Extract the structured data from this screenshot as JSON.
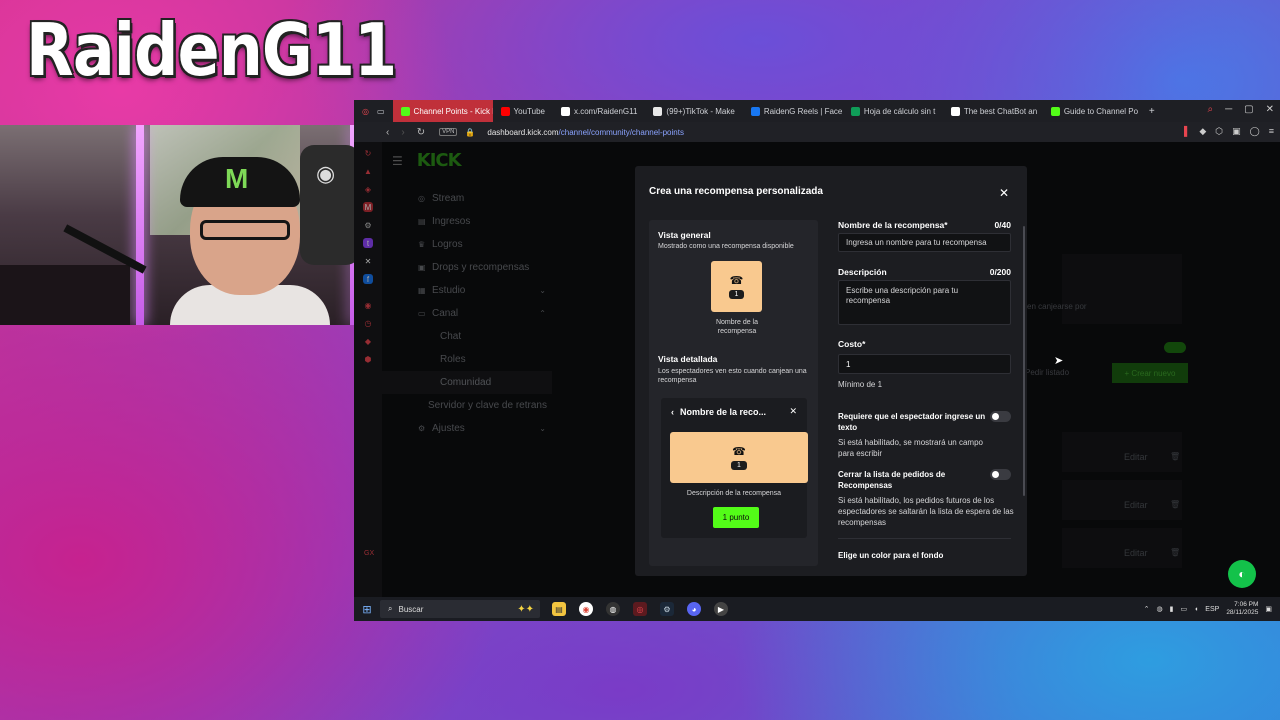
{
  "overlay": {
    "streamer_name": "RaidenG11"
  },
  "browser": {
    "tabs": [
      {
        "label": "Channel Points - Kick Da",
        "color": "#53fc18",
        "active": true
      },
      {
        "label": "YouTube",
        "color": "#ff0000"
      },
      {
        "label": "x.com/RaidenG11",
        "color": "#ffffff"
      },
      {
        "label": "(99+)TikTok - Make",
        "color": "#e8e8e8"
      },
      {
        "label": "RaidenG Reels | Face",
        "color": "#1877f2"
      },
      {
        "label": "Hoja de cálculo sin t",
        "color": "#0f9d58"
      },
      {
        "label": "The best ChatBot an",
        "color": "#ffffff"
      },
      {
        "label": "Guide to Channel Po",
        "color": "#53fc18"
      }
    ],
    "vpn_badge": "VPN",
    "url_host": "dashboard.kick.com",
    "url_path": "/channel/community/channel-points"
  },
  "kick": {
    "logo": "KICK",
    "sidebar": [
      {
        "label": "Stream",
        "icon": "radio-icon",
        "glyph": "◎",
        "level": "top"
      },
      {
        "label": "Ingresos",
        "icon": "money-icon",
        "glyph": "▤",
        "level": "top"
      },
      {
        "label": "Logros",
        "icon": "trophy-icon",
        "glyph": "♛",
        "level": "top"
      },
      {
        "label": "Drops y recompensas",
        "icon": "gift-icon",
        "glyph": "▣",
        "level": "top"
      },
      {
        "label": "Estudio",
        "icon": "studio-icon",
        "glyph": "▦",
        "level": "top",
        "chevron": "⌄"
      },
      {
        "label": "Canal",
        "icon": "channel-icon",
        "glyph": "▭",
        "level": "top",
        "chevron": "⌃"
      },
      {
        "label": "Chat",
        "level": "sub"
      },
      {
        "label": "Roles",
        "level": "sub"
      },
      {
        "label": "Comunidad",
        "level": "sub",
        "active": true
      },
      {
        "label": "Servidor y clave de retrans",
        "level": "plain"
      },
      {
        "label": "Ajustes",
        "icon": "settings-icon",
        "glyph": "⚙",
        "level": "top",
        "chevron": "⌄"
      }
    ],
    "bg": {
      "redeem_text": "en canjearse por",
      "edit_list": "Pedir listado",
      "create_new": "+ Crear nuevo",
      "edit_label": "Editar"
    }
  },
  "modal": {
    "title": "Crea una recompensa personalizada",
    "overview_title": "Vista general",
    "overview_sub": "Mostrado como una recompensa disponible",
    "tile_cost": "1",
    "tile_name": "Nombre de la recompensa",
    "detail_title": "Vista detallada",
    "detail_sub": "Los espectadores ven esto cuando canjean una recompensa",
    "detail_card_title": "Nombre de la reco...",
    "detail_card_desc": "Descripción de la recompensa",
    "points_button": "1 punto",
    "name_label": "Nombre de la recompensa*",
    "name_count": "0/40",
    "name_placeholder": "Ingresa un nombre para tu recompensa",
    "desc_label": "Descripción",
    "desc_count": "0/200",
    "desc_placeholder": "Escribe una descripción para tu recompensa",
    "cost_label": "Costo*",
    "cost_value": "1",
    "cost_min": "Mínimo de 1",
    "require_text_title": "Requiere que el espectador ingrese un texto",
    "require_text_desc": "Si está habilitado, se mostrará un campo para escribir",
    "close_queue_title": "Cerrar la lista de pedidos de Recompensas",
    "close_queue_desc": "Si está habilitado, los pedidos futuros de los espectadores se saltarán la lista de espera de las recompensas",
    "color_label": "Elige un color para el fondo"
  },
  "taskbar": {
    "search_label": "Buscar",
    "language": "ESP",
    "time": "7:06 PM",
    "date": "28/11/2025"
  }
}
